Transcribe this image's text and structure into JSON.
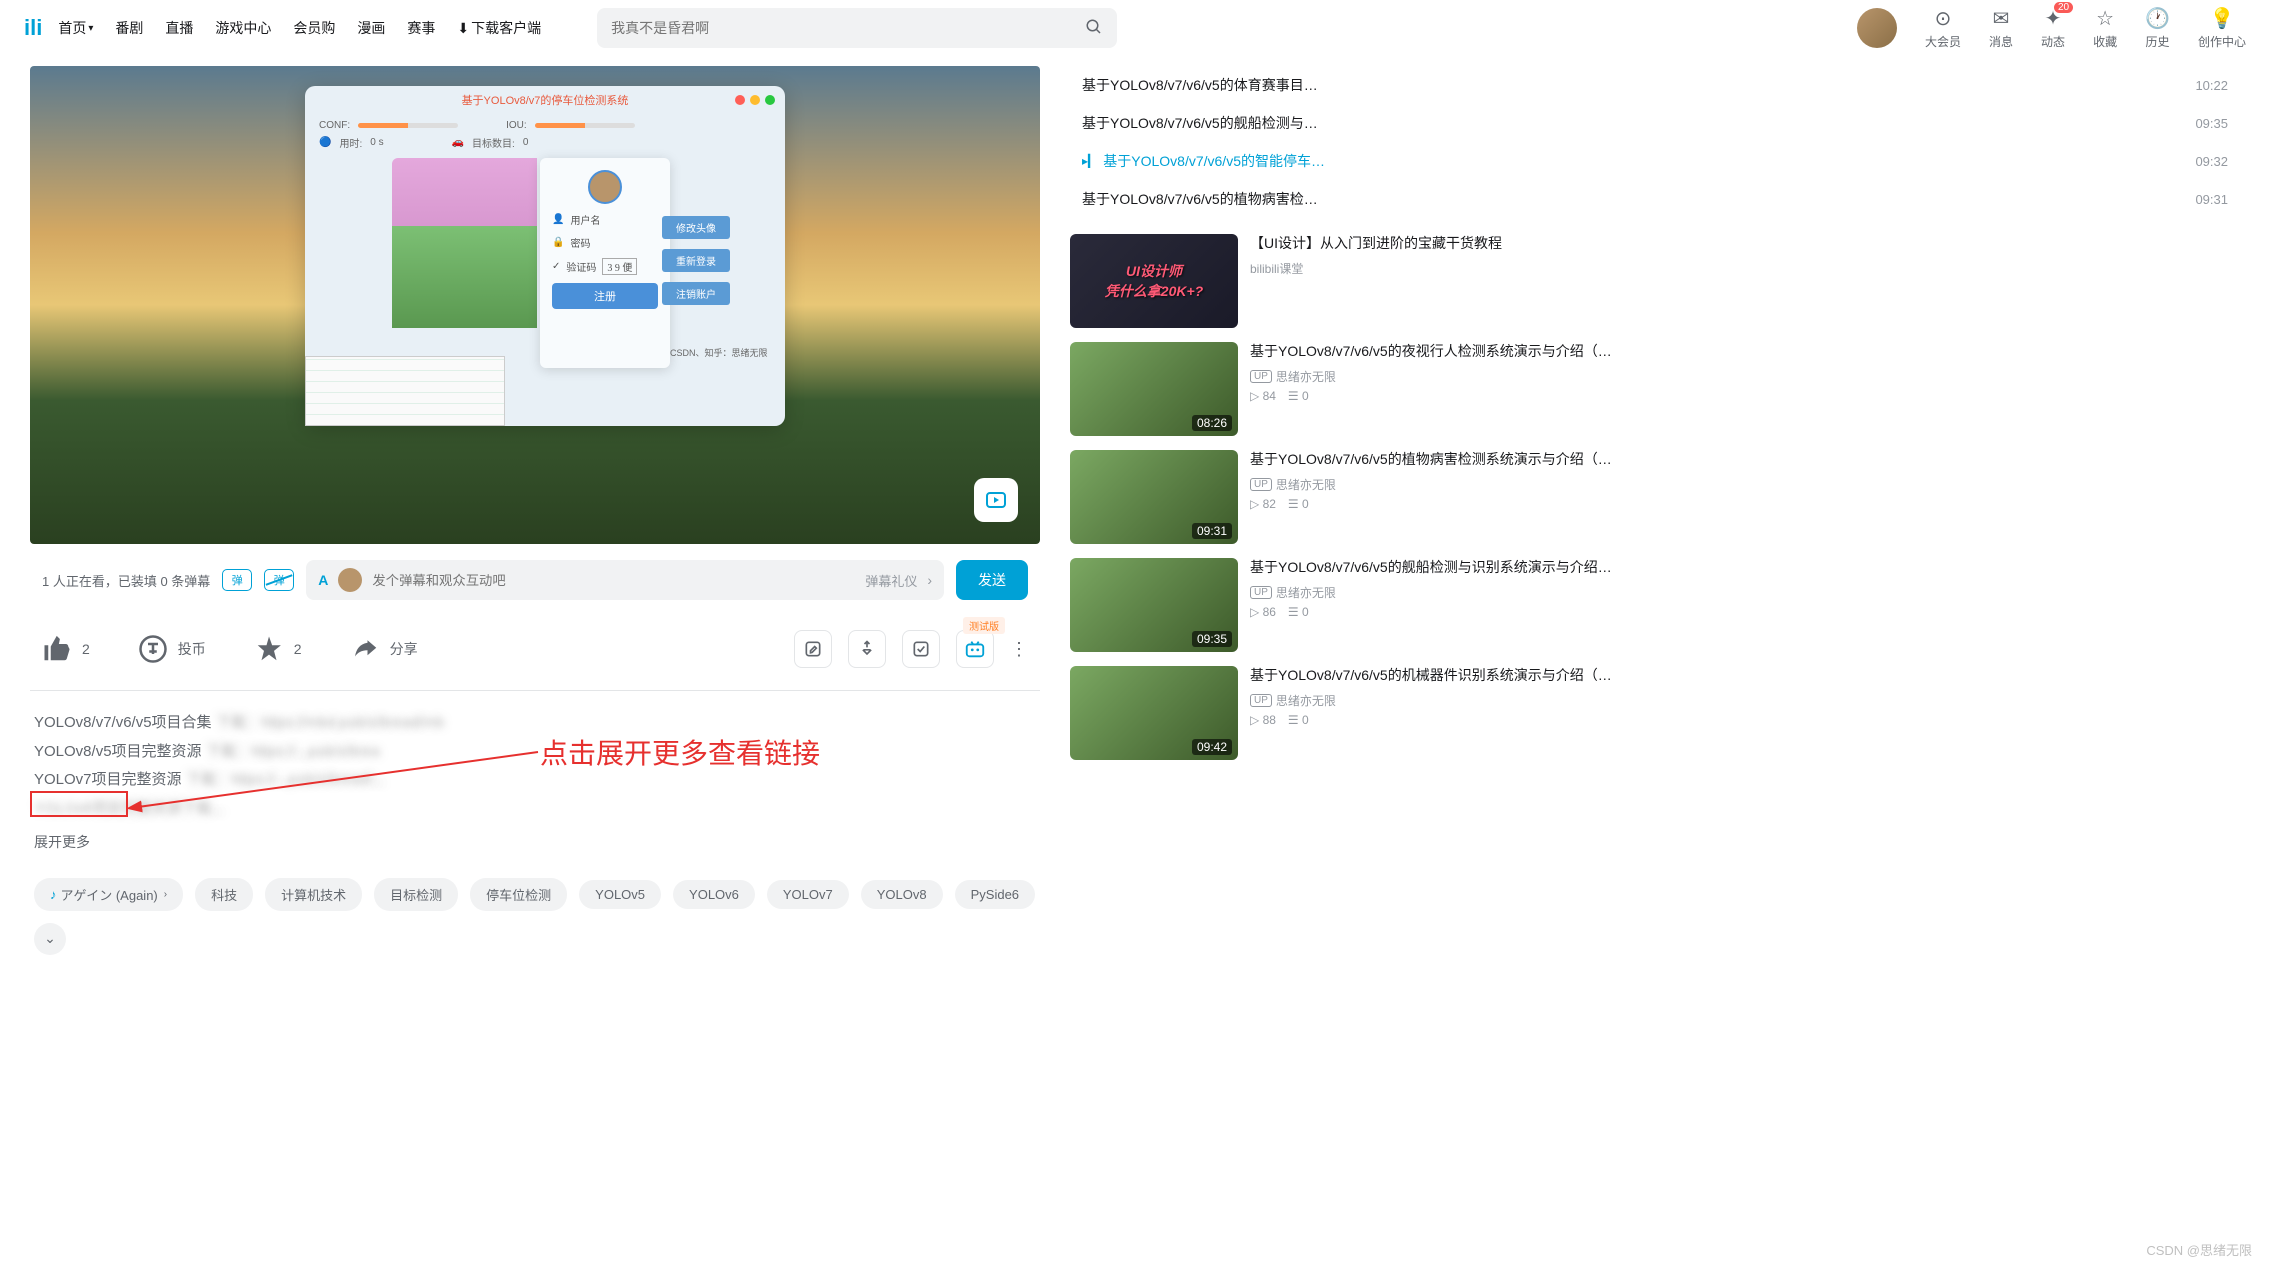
{
  "header": {
    "nav": [
      "首页",
      "番剧",
      "直播",
      "游戏中心",
      "会员购",
      "漫画",
      "赛事",
      "下载客户端"
    ],
    "download_icon": "⬇",
    "search_placeholder": "我真不是昏君啊",
    "right": [
      {
        "icon": "⊙",
        "label": "大会员"
      },
      {
        "icon": "✉",
        "label": "消息"
      },
      {
        "icon": "✦",
        "label": "动态",
        "badge": "20"
      },
      {
        "icon": "☆",
        "label": "收藏"
      },
      {
        "icon": "🕐",
        "label": "历史"
      },
      {
        "icon": "💡",
        "label": "创作中心"
      }
    ]
  },
  "player": {
    "app_title": "基于YOLOv8/v7的停车位检测系统",
    "conf_label": "CONF:",
    "iou_label": "IOU:",
    "time_label": "用时:",
    "time_value": "0 s",
    "target_label": "目标数目:",
    "target_value": "0",
    "login": {
      "user_label": "用户名",
      "pwd_label": "密码",
      "captcha_label": "验证码",
      "captcha_val": "3 9 便",
      "register": "注册"
    },
    "side_btns": [
      "修改头像",
      "重新登录",
      "注销账户"
    ],
    "csdn_line": "CSDN、知乎：思绪无限"
  },
  "danmaku": {
    "stat": "1 人正在看，已装填 0 条弹幕",
    "toggle1": "弹",
    "toggle2": "弹",
    "font_label": "A",
    "placeholder": "发个弹幕和观众互动吧",
    "etiquette": "弹幕礼仪",
    "send": "发送"
  },
  "actions": {
    "like": "2",
    "coin": "投币",
    "fav": "2",
    "share": "分享",
    "test_badge": "测试版"
  },
  "desc": {
    "lines": [
      {
        "text": "YOLOv8/v7/v6/v5项目合集",
        "blur": "下载：https://mbd.pub/o/bread/mb"
      },
      {
        "text": "YOLOv8/v5项目完整资源",
        "blur": "下载：https://...pub/o/brea"
      },
      {
        "text": "YOLOv7项目完整资源",
        "blur": "下载：https://...pub/o/bread/..."
      },
      {
        "text": "",
        "blur": "YOLOv6项目完整资源下载..."
      }
    ],
    "expand": "展开更多",
    "annotation": "点击展开更多查看链接"
  },
  "tags": {
    "music": "アゲイン (Again)",
    "list": [
      "科技",
      "计算机技术",
      "目标检测",
      "停车位检测",
      "YOLOv5",
      "YOLOv6",
      "YOLOv7",
      "YOLOv8",
      "PySide6"
    ]
  },
  "playlist": [
    {
      "title": "基于YOLOv8/v7/v6/v5的体育赛事目…",
      "time": "10:22"
    },
    {
      "title": "基于YOLOv8/v7/v6/v5的舰船检测与…",
      "time": "09:35"
    },
    {
      "title": "基于YOLOv8/v7/v6/v5的智能停车…",
      "time": "09:32",
      "active": true
    },
    {
      "title": "基于YOLOv8/v7/v6/v5的植物病害检…",
      "time": "09:31"
    }
  ],
  "reco": [
    {
      "title": "【UI设计】从入门到进阶的宝藏干货教程",
      "up": "bilibili课堂",
      "dur": "",
      "overlay": [
        "UI设计师",
        "凭什么拿20K+?"
      ],
      "thumb": "dark",
      "views": "",
      "dm": ""
    },
    {
      "title": "基于YOLOv8/v7/v6/v5的夜视行人检测系统演示与介绍（…",
      "up": "思绪亦无限",
      "dur": "08:26",
      "views": "84",
      "dm": "0"
    },
    {
      "title": "基于YOLOv8/v7/v6/v5的植物病害检测系统演示与介绍（…",
      "up": "思绪亦无限",
      "dur": "09:31",
      "views": "82",
      "dm": "0"
    },
    {
      "title": "基于YOLOv8/v7/v6/v5的舰船检测与识别系统演示与介绍…",
      "up": "思绪亦无限",
      "dur": "09:35",
      "views": "86",
      "dm": "0"
    },
    {
      "title": "基于YOLOv8/v7/v6/v5的机械器件识别系统演示与介绍（…",
      "up": "思绪亦无限",
      "dur": "09:42",
      "views": "88",
      "dm": "0"
    }
  ],
  "watermark": "CSDN @思绪无限"
}
